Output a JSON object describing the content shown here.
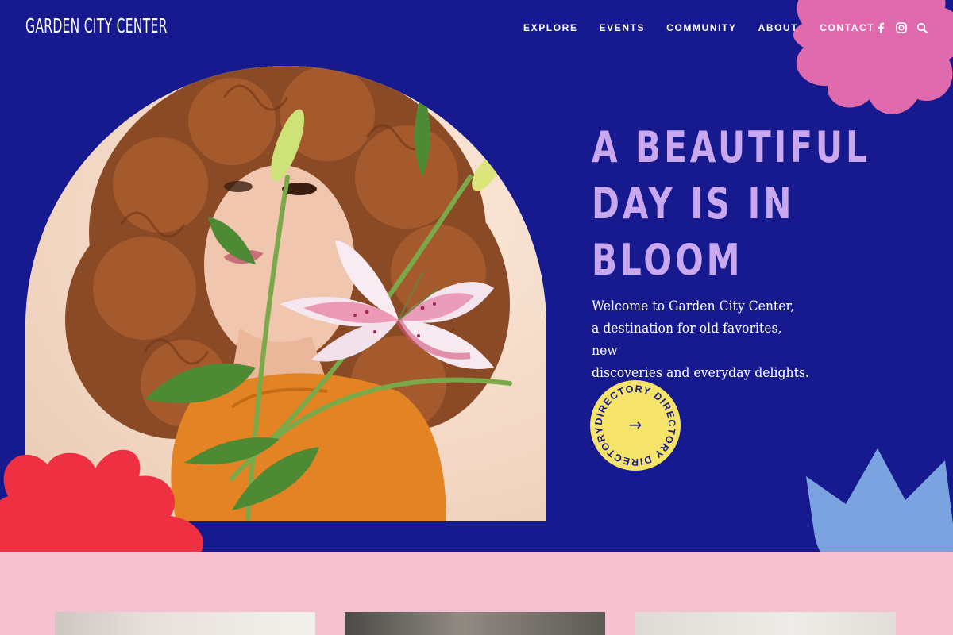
{
  "brand": {
    "logo_text": "GARDEN CITY CENTER"
  },
  "nav": {
    "items": [
      {
        "label": "EXPLORE"
      },
      {
        "label": "EVENTS"
      },
      {
        "label": "COMMUNITY"
      },
      {
        "label": "ABOUT"
      },
      {
        "label": "CONTACT"
      }
    ],
    "social_icons": [
      "facebook-icon",
      "instagram-icon",
      "search-icon"
    ]
  },
  "hero": {
    "headline_lines": [
      "A BEAUTIFUL",
      "DAY IS IN",
      "BLOOM"
    ],
    "intro_lines": [
      "Welcome to Garden City Center,",
      "a destination for old favorites, new",
      "discoveries and everyday delights."
    ],
    "directory_button": {
      "ring_text": "DIRECTORY DIRECTORY DIRECTORY",
      "arrow": "→"
    }
  },
  "colors": {
    "hero_bg": "#171a8f",
    "headline": "#c9a8ef",
    "page_bg": "#f5c0cf",
    "pink_shape": "#e06aae",
    "red_shape": "#ee3042",
    "blue_shape": "#7aa3df",
    "directory_badge": "#f6e46a"
  }
}
